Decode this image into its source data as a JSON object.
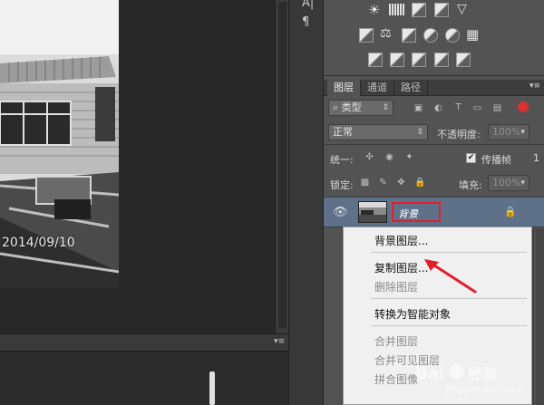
{
  "canvas": {
    "date_stamp": "2014/09/10"
  },
  "toolbar": {
    "icons": [
      "text-icon",
      "paragraph-icon"
    ]
  },
  "adjustments": {
    "icons": [
      "brightness-icon",
      "levels-icon",
      "curves-icon",
      "exposure-icon",
      "vibrance-icon",
      "hue-saturation-icon",
      "color-balance-icon",
      "black-white-icon",
      "photo-filter-icon",
      "channel-mixer-icon",
      "color-lookup-icon",
      "invert-icon",
      "posterize-icon",
      "threshold-icon",
      "selective-color-icon",
      "gradient-map-icon"
    ]
  },
  "layers_panel": {
    "tabs": [
      {
        "label": "图层",
        "active": true
      },
      {
        "label": "通道",
        "active": false
      },
      {
        "label": "路径",
        "active": false
      }
    ],
    "filter_label": "类型",
    "blend_mode": "正常",
    "opacity_label": "不透明度:",
    "opacity_value": "100%",
    "unify_label": "统一:",
    "propagate_label": "传播帧",
    "propagate_number": "1",
    "lock_label": "锁定:",
    "fill_label": "填充:",
    "fill_value": "100%",
    "layer": {
      "name": "背景"
    }
  },
  "context_menu": {
    "items": [
      {
        "label": "背景图层...",
        "disabled": false
      },
      {
        "label": "复制图层...",
        "disabled": false
      },
      {
        "label": "删除图层",
        "disabled": true
      },
      {
        "label": "转换为智能对象",
        "disabled": false
      },
      {
        "label": "合并图层",
        "disabled": true
      },
      {
        "label": "合并可见图层",
        "disabled": true
      },
      {
        "label": "拼合图像",
        "disabled": true
      }
    ]
  },
  "colors": {
    "highlight_red": "#e0202c",
    "selected_layer": "#5f7189"
  }
}
